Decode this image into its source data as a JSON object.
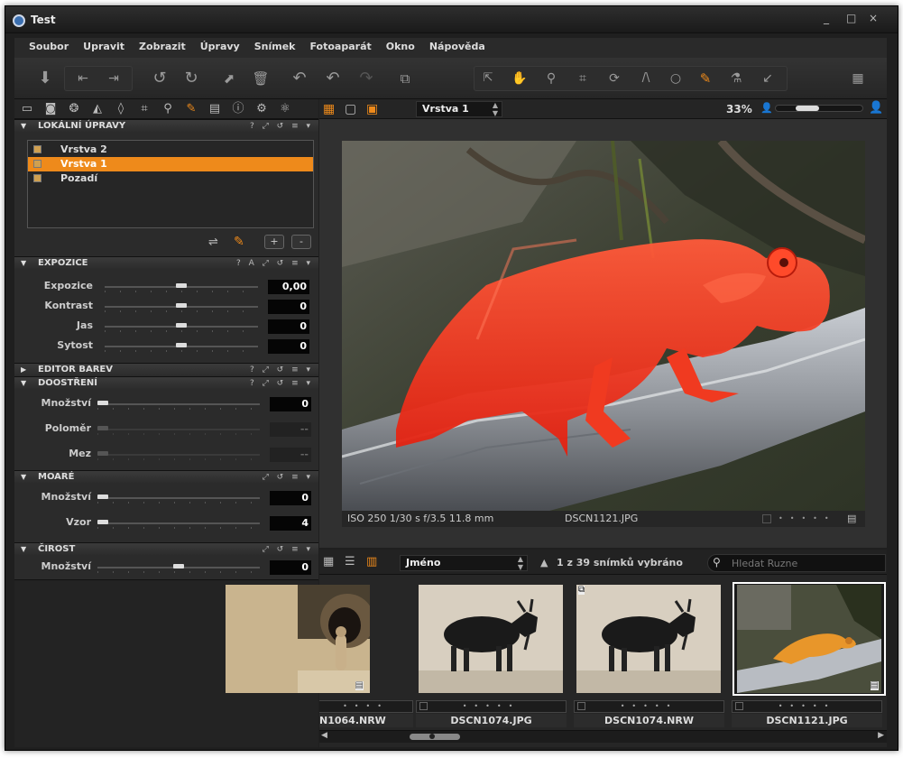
{
  "window": {
    "title": "Test",
    "controls": [
      "_",
      "□",
      "×"
    ]
  },
  "menu": [
    "Soubor",
    "Upravit",
    "Zobrazit",
    "Úpravy",
    "Snímek",
    "Fotoaparát",
    "Okno",
    "Nápověda"
  ],
  "toolbar": {
    "icons": [
      "import-icon",
      "rotate-left-view-icon",
      "rotate-right-view-icon",
      "rotate-ccw-icon",
      "rotate-cw-icon",
      "export-icon",
      "trash-icon",
      "undo-all-icon",
      "undo-icon",
      "redo-icon",
      "multi-view-icon",
      "select-tool-icon",
      "pan-tool-icon",
      "zoom-tool-icon",
      "crop-tool-icon",
      "rotate-tool-icon",
      "keystone-tool-icon",
      "spot-tool-icon",
      "brush-tool-icon",
      "picker-tool-icon",
      "annotate-tool-icon",
      "workspace-icon"
    ]
  },
  "left_panel": {
    "local_adjustments": {
      "title": "LOKÁLNÍ ÚPRAVY",
      "layers": [
        {
          "name": "Vrstva 2",
          "checked": true,
          "selected": false
        },
        {
          "name": "Vrstva 1",
          "checked": true,
          "selected": true
        },
        {
          "name": "Pozadí",
          "checked": true,
          "selected": false
        }
      ],
      "add_label": "+",
      "remove_label": "-"
    },
    "exposure": {
      "title": "EXPOZICE",
      "header_icons": "? A ⤢ ↺ ≡ ▾",
      "sliders": [
        {
          "label": "Expozice",
          "value": "0,00",
          "level": 0.5
        },
        {
          "label": "Kontrast",
          "value": "0",
          "level": 0.5
        },
        {
          "label": "Jas",
          "value": "0",
          "level": 0.5
        },
        {
          "label": "Sytost",
          "value": "0",
          "level": 0.5
        }
      ]
    },
    "color_editor": {
      "title": "EDITOR BAREV"
    },
    "sharpening": {
      "title": "DOOSTŘENÍ",
      "sliders": [
        {
          "label": "Množství",
          "value": "0",
          "level": 0,
          "disabled": false
        },
        {
          "label": "Poloměr",
          "value": "--",
          "level": 0,
          "disabled": true
        },
        {
          "label": "Mez",
          "value": "--",
          "level": 0,
          "disabled": true
        }
      ]
    },
    "moire": {
      "title": "MOARÉ",
      "sliders": [
        {
          "label": "Množství",
          "value": "0",
          "level": 0
        },
        {
          "label": "Vzor",
          "value": "4",
          "level": 0
        }
      ]
    },
    "clarity": {
      "title": "ČIROST",
      "sliders": [
        {
          "label": "Množství",
          "value": "0",
          "level": 0.5
        }
      ]
    }
  },
  "viewer": {
    "layer_select": "Vrstva 1",
    "zoom": "33%",
    "info_left": "ISO 250  1/30 s  f/3.5  11.8 mm",
    "info_file": "DSCN1121.JPG"
  },
  "browser": {
    "sort_by": "Jméno",
    "selection_count": "1 z 39 snímků vybráno",
    "search_placeholder": "Hledat Ruzne",
    "thumbnails": [
      {
        "name": "N1064.NRW",
        "subject": "meerkat"
      },
      {
        "name": "DSCN1074.JPG",
        "subject": "goat"
      },
      {
        "name": "DSCN1074.NRW",
        "subject": "goat"
      },
      {
        "name": "DSCN1121.JPG",
        "subject": "chameleon",
        "selected": true
      }
    ]
  }
}
